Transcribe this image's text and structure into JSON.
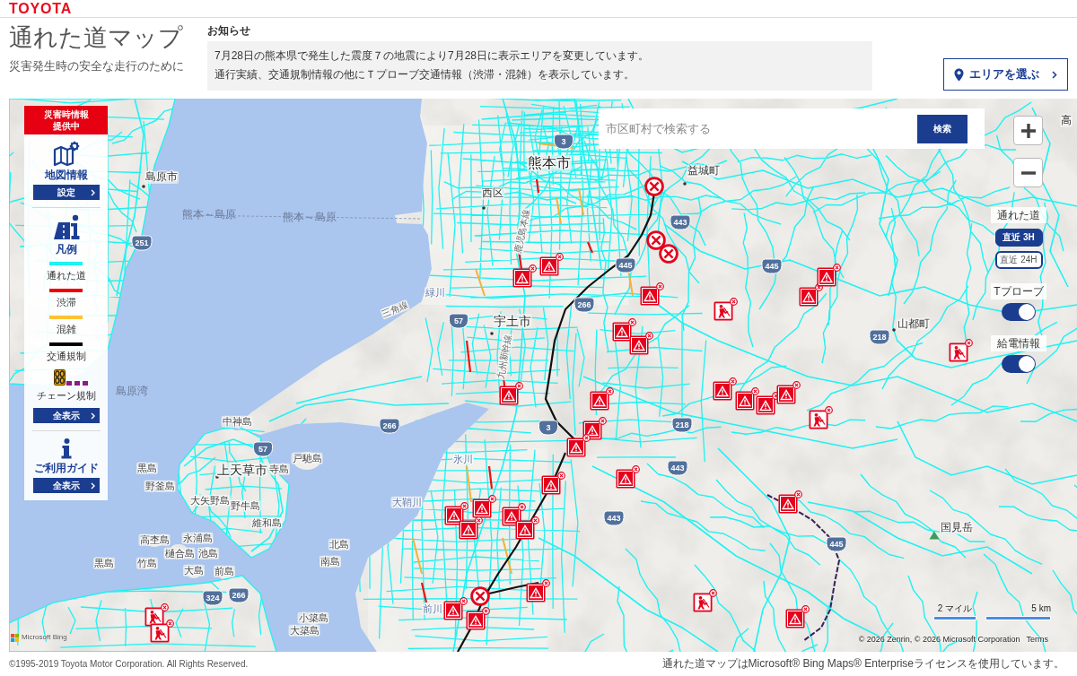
{
  "header": {
    "logo": "TOYOTA",
    "title": "通れた道マップ",
    "subtitle": "災害発生時の安全な走行のために"
  },
  "notice": {
    "heading": "お知らせ",
    "lines": [
      "7月28日の熊本県で発生した震度７の地震により7月28日に表示エリアを変更しています。",
      "通行実績、交通規制情報の他にＴプローブ交通情報（渋滞・混雑）を表示しています。"
    ]
  },
  "area_button": {
    "label": "エリアを選ぶ"
  },
  "side_panel": {
    "alert": [
      "災害時情報",
      "提供中"
    ],
    "map_info": {
      "title": "地図情報",
      "button": "設定"
    },
    "legend": {
      "title": "凡例",
      "items": [
        {
          "label": "通れた道",
          "kind": "line",
          "color": "#1ef2f2"
        },
        {
          "label": "渋滞",
          "kind": "line",
          "color": "#ee0000"
        },
        {
          "label": "混雑",
          "kind": "line",
          "color": "#fdc236"
        },
        {
          "label": "交通規制",
          "kind": "line",
          "color": "#000000"
        },
        {
          "label": "チェーン規制",
          "kind": "chain",
          "color": "#8b1a8b"
        }
      ],
      "button": "全表示"
    },
    "guide": {
      "title": "ご利用ガイド",
      "button": "全表示"
    }
  },
  "search": {
    "placeholder": "市区町村で検索する",
    "button": "検索"
  },
  "layers": {
    "roads": {
      "title": "通れた道",
      "options": [
        {
          "label": "直近 3H",
          "selected": true
        },
        {
          "label": "直近 24H",
          "selected": false
        }
      ]
    },
    "toggles": [
      {
        "label": "Tプローブ",
        "on": true
      },
      {
        "label": "給電情報",
        "on": true
      }
    ]
  },
  "map": {
    "labels": [
      {
        "text": "高",
        "kind": "town"
      },
      {
        "text": "熊本市",
        "kind": "major_city"
      },
      {
        "text": "益城町",
        "kind": "town"
      },
      {
        "text": "島原市",
        "kind": "town"
      },
      {
        "text": "西区",
        "kind": "district"
      },
      {
        "text": "熊本～島原",
        "kind": "ferry"
      },
      {
        "text": "熊本～島原",
        "kind": "ferry"
      },
      {
        "text": "鹿児島本線",
        "kind": "rail"
      },
      {
        "text": "緑川",
        "kind": "river"
      },
      {
        "text": "三角線",
        "kind": "rail"
      },
      {
        "text": "宇土市",
        "kind": "city"
      },
      {
        "text": "山都町",
        "kind": "town"
      },
      {
        "text": "九州新幹線",
        "kind": "rail"
      },
      {
        "text": "島原湾",
        "kind": "water"
      },
      {
        "text": "中神島",
        "kind": "island"
      },
      {
        "text": "戸馳島",
        "kind": "island"
      },
      {
        "text": "氷川",
        "kind": "river"
      },
      {
        "text": "黒島",
        "kind": "island"
      },
      {
        "text": "上天草市",
        "kind": "city"
      },
      {
        "text": "寺島",
        "kind": "island"
      },
      {
        "text": "野釜島",
        "kind": "island"
      },
      {
        "text": "大矢野島",
        "kind": "island"
      },
      {
        "text": "野牛島",
        "kind": "island"
      },
      {
        "text": "大鞘川",
        "kind": "river"
      },
      {
        "text": "維和島",
        "kind": "island"
      },
      {
        "text": "国見岳",
        "kind": "peak"
      },
      {
        "text": "高杢島",
        "kind": "island"
      },
      {
        "text": "永浦島",
        "kind": "island"
      },
      {
        "text": "北島",
        "kind": "island"
      },
      {
        "text": "樋合島",
        "kind": "island"
      },
      {
        "text": "池島",
        "kind": "island"
      },
      {
        "text": "黒島",
        "kind": "island"
      },
      {
        "text": "竹島",
        "kind": "island"
      },
      {
        "text": "南島",
        "kind": "island"
      },
      {
        "text": "大島",
        "kind": "island"
      },
      {
        "text": "前島",
        "kind": "island"
      },
      {
        "text": "前川",
        "kind": "river"
      },
      {
        "text": "小築島",
        "kind": "island"
      },
      {
        "text": "大築島",
        "kind": "island"
      }
    ],
    "route_shields": [
      "3",
      "443",
      "251",
      "445",
      "445",
      "266",
      "57",
      "218",
      "266",
      "3",
      "218",
      "57",
      "443",
      "443",
      "445",
      "324",
      "266"
    ],
    "scale": [
      "2 マイル",
      "5 km"
    ],
    "attribution": "© 2026 Zenrin, © 2026 Microsoft Corporation",
    "terms": "Terms",
    "provider": "Microsoft Bing"
  },
  "footer": {
    "copyright": "©1995-2019 Toyota Motor Corporation. All Rights Reserved.",
    "license": "通れた道マップはMicrosoft® Bing Maps® Enterpriseライセンスを使用しています。"
  }
}
